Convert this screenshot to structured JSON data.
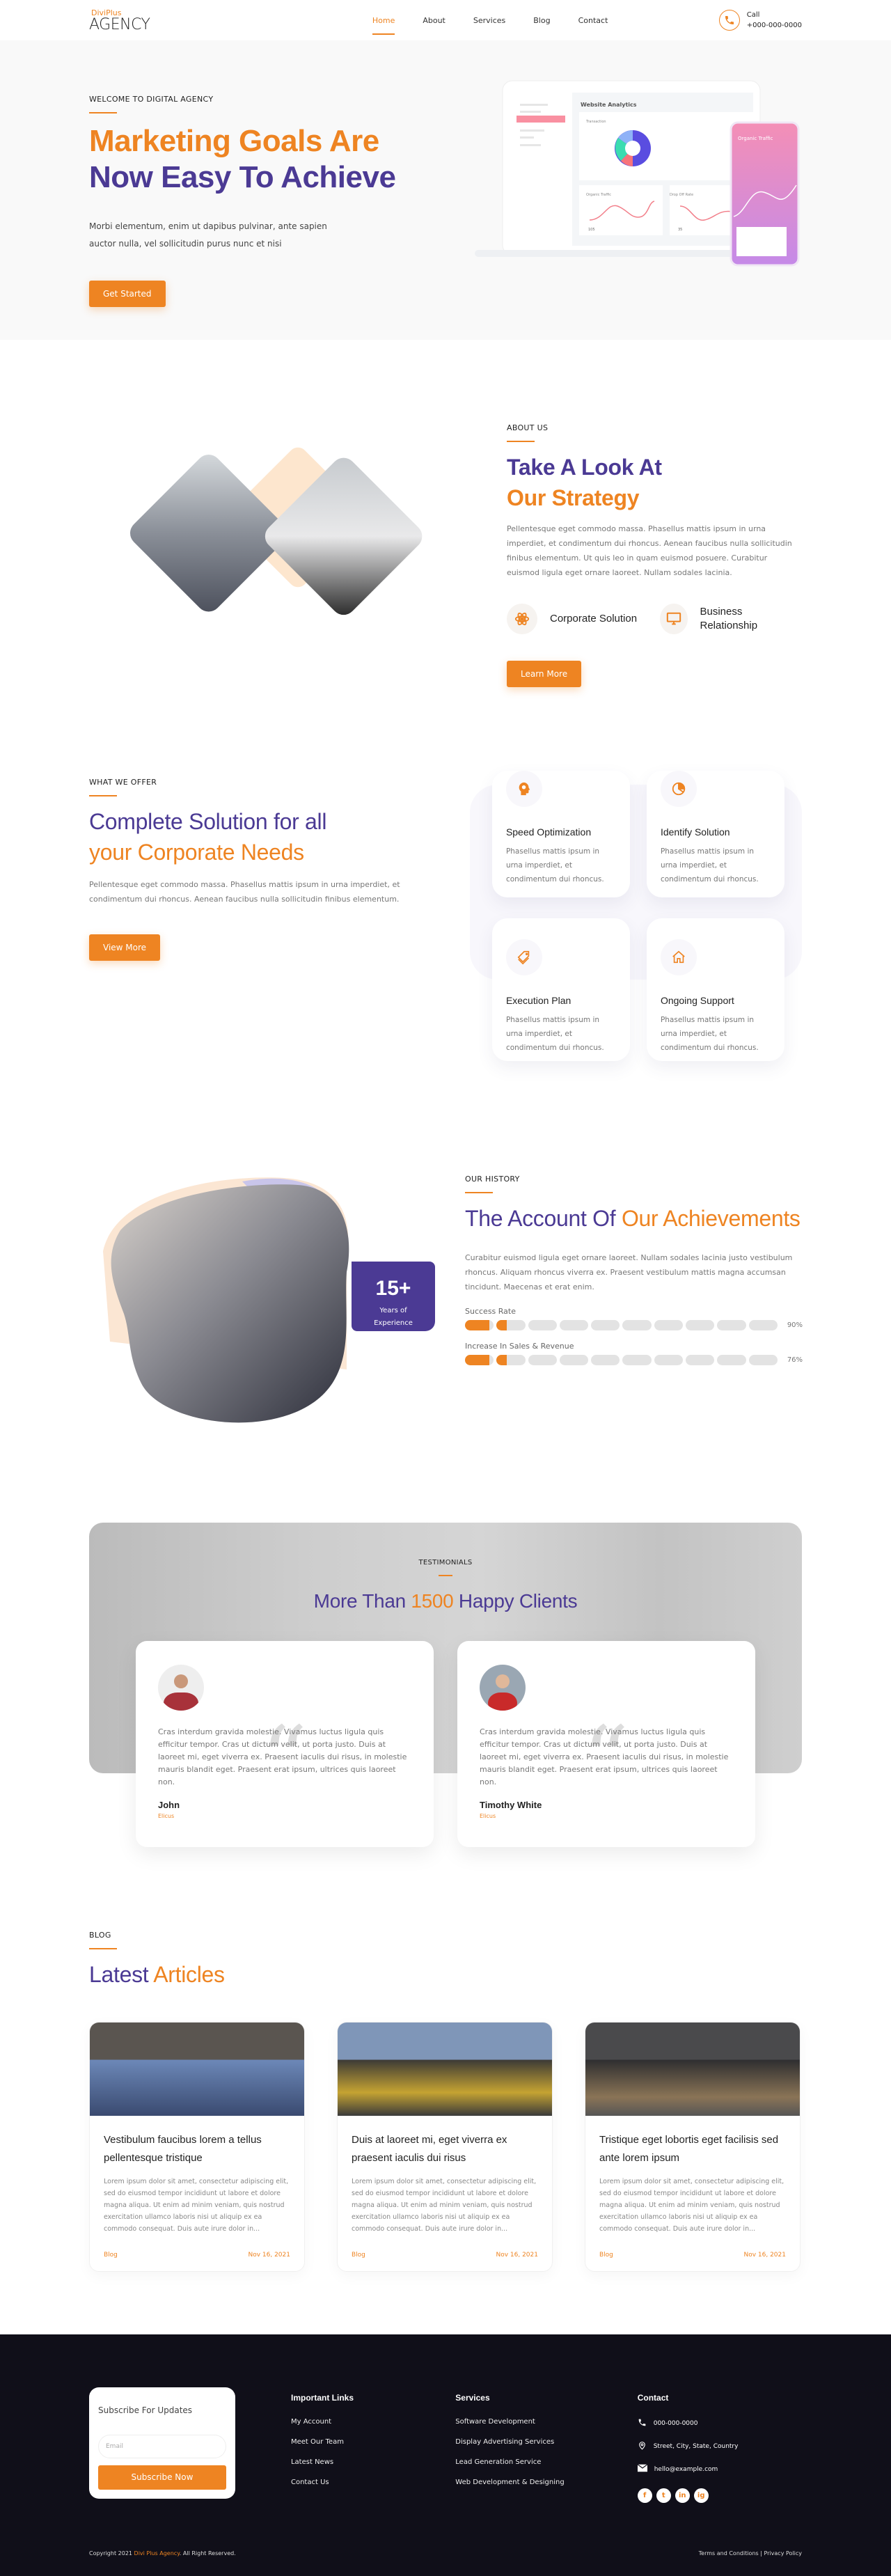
{
  "colors": {
    "accent": "#ee8422",
    "primary": "#4b3a94",
    "footer_bg": "#100f19"
  },
  "header": {
    "logo_top": "DiviPlus",
    "logo_main": "AGENCY",
    "nav": [
      {
        "label": "Home",
        "active": true
      },
      {
        "label": "About"
      },
      {
        "label": "Services"
      },
      {
        "label": "Blog"
      },
      {
        "label": "Contact"
      }
    ],
    "call_label": "Call",
    "call_number": "+000-000-0000"
  },
  "hero": {
    "eyebrow": "WELCOME TO DIGITAL AGENCY",
    "title_line1": "Marketing Goals Are",
    "title_line2": "Now Easy To Achieve",
    "text": "Morbi elementum, enim ut dapibus pulvinar, ante sapien auctor nulla, vel sollicitudin purus nunc et nisi",
    "cta": "Get Started",
    "mockup": {
      "dashboard_title": "Website Analytics",
      "card1": "Transaction",
      "card2": "Organic Traffic",
      "card2_value": "105",
      "card3": "Drop Off Rate",
      "card3_value": "35",
      "phone_title": "Organic Traffic"
    }
  },
  "about": {
    "eyebrow": "ABOUT US",
    "title_line1": "Take A Look At",
    "title_line2": "Our Strategy",
    "text": "Pellentesque eget commodo massa. Phasellus mattis ipsum in urna imperdiet, et condimentum dui rhoncus. Aenean faucibus nulla sollicitudin finibus elementum. Ut quis leo in quam euismod posuere. Curabitur euismod ligula eget ornare laoreet. Nullam sodales lacinia.",
    "features": [
      {
        "icon": "atom-icon",
        "label": "Corporate Solution"
      },
      {
        "icon": "monitor-icon",
        "label": "Business Relationship"
      }
    ],
    "cta": "Learn More"
  },
  "offer": {
    "eyebrow": "WHAT WE OFFER",
    "title_line1": "Complete Solution for all",
    "title_line2": "your Corporate Needs",
    "text": "Pellentesque eget commodo massa. Phasellus mattis ipsum in urna imperdiet, et condimentum dui rhoncus. Aenean faucibus nulla sollicitudin finibus elementum.",
    "cta": "View More",
    "cards": [
      {
        "icon": "brain-gear-icon",
        "title": "Speed Optimization",
        "text": "Phasellus mattis ipsum in urna imperdiet, et condimentum dui rhoncus."
      },
      {
        "icon": "pie-chart-icon",
        "title": "Identify Solution",
        "text": "Phasellus mattis ipsum in urna imperdiet, et condimentum dui rhoncus."
      },
      {
        "icon": "tag-icon",
        "title": "Execution Plan",
        "text": "Phasellus mattis ipsum in urna imperdiet, et condimentum dui rhoncus."
      },
      {
        "icon": "home-icon",
        "title": "Ongoing Support",
        "text": "Phasellus mattis ipsum in urna imperdiet, et condimentum dui rhoncus."
      }
    ]
  },
  "history": {
    "badge_value": "15+",
    "badge_label": "Years of Experience",
    "eyebrow": "OUR HISTORY",
    "title_part1": "The Account Of ",
    "title_part2": "Our Achievements",
    "text": "Curabitur euismod ligula eget ornare laoreet. Nullam sodales lacinia justo vestibulum rhoncus. Aliquam rhoncus viverra ex. Praesent vestibulum mattis magna accumsan tincidunt. Maecenas et erat enim.",
    "bars": [
      {
        "label": "Success Rate",
        "percent_label": "90%",
        "value": 90
      },
      {
        "label": "Increase In Sales & Revenue",
        "percent_label": "76%",
        "value": 76
      }
    ]
  },
  "testimonials": {
    "eyebrow": "TESTIMONIALS",
    "title_part1": "More Than ",
    "title_part2": "1500",
    "title_part3": " Happy Clients",
    "items": [
      {
        "name": "John",
        "role": "Elicus",
        "text": "Cras interdum gravida molestie. Vivamus luctus ligula quis efficitur tempor. Cras ut dictum velit, ut porta justo. Duis at laoreet mi, eget viverra ex. Praesent iaculis dui risus, in molestie mauris blandit eget. Praesent erat ipsum, ultrices quis laoreet non."
      },
      {
        "name": "Timothy White",
        "role": "Elicus",
        "text": "Cras interdum gravida molestie. Vivamus luctus ligula quis efficitur tempor. Cras ut dictum velit, ut porta justo. Duis at laoreet mi, eget viverra ex. Praesent iaculis dui risus, in molestie mauris blandit eget. Praesent erat ipsum, ultrices quis laoreet non."
      }
    ]
  },
  "blog": {
    "eyebrow": "BLOG",
    "title_part1": "Latest ",
    "title_part2": "Articles",
    "posts": [
      {
        "title": "Vestibulum faucibus lorem a tellus pellentesque tristique",
        "excerpt": "Lorem ipsum dolor sit amet, consectetur adipiscing elit, sed do eiusmod tempor incididunt ut labore et dolore magna aliqua. Ut enim ad minim veniam, quis nostrud exercitation ullamco laboris nisi ut aliquip ex ea commodo consequat. Duis aute irure dolor in...",
        "category": "Blog",
        "date": "Nov 16, 2021"
      },
      {
        "title": "Duis at laoreet mi, eget viverra ex praesent iaculis dui risus",
        "excerpt": "Lorem ipsum dolor sit amet, consectetur adipiscing elit, sed do eiusmod tempor incididunt ut labore et dolore magna aliqua. Ut enim ad minim veniam, quis nostrud exercitation ullamco laboris nisi ut aliquip ex ea commodo consequat. Duis aute irure dolor in...",
        "category": "Blog",
        "date": "Nov 16, 2021"
      },
      {
        "title": "Tristique eget lobortis eget facilisis sed ante lorem ipsum",
        "excerpt": "Lorem ipsum dolor sit amet, consectetur adipiscing elit, sed do eiusmod tempor incididunt ut labore et dolore magna aliqua. Ut enim ad minim veniam, quis nostrud exercitation ullamco laboris nisi ut aliquip ex ea commodo consequat. Duis aute irure dolor in...",
        "category": "Blog",
        "date": "Nov 16, 2021"
      }
    ]
  },
  "footer": {
    "subscribe_title": "Subscribe For Updates",
    "email_placeholder": "Email",
    "subscribe_button": "Subscribe Now",
    "links_title": "Important Links",
    "links": [
      "My Account",
      "Meet Our Team",
      "Latest News",
      "Contact Us"
    ],
    "services_title": "Services",
    "services": [
      "Software Development",
      "Display Advertising Services",
      "Lead Generation Service",
      "Web Development & Designing"
    ],
    "contact_title": "Contact",
    "phone": "000-000-0000",
    "address": "Street, City, State, Country",
    "email": "hello@example.com",
    "social": [
      "f",
      "t",
      "in",
      "ig"
    ],
    "copy_prefix": "Copyright 2021 ",
    "copy_brand": "Divi Plus Agency",
    "copy_suffix": ". All Right Reserved.",
    "terms": "Terms and Conditions",
    "separator": " | ",
    "privacy": "Privacy Policy"
  }
}
